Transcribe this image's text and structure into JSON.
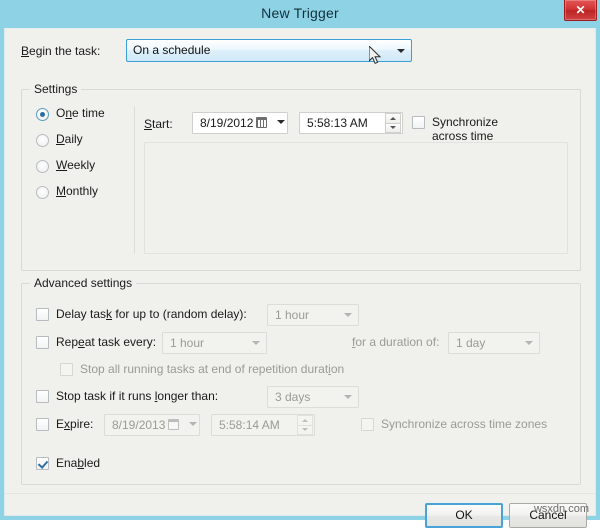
{
  "window": {
    "title": "New Trigger",
    "close_label": "✕",
    "accent_title_bg": "#8ed2e6",
    "body_bg": "#f0f0ec",
    "accent_focus": "#4aa3d6"
  },
  "begin": {
    "label": "Begin the task:",
    "value": "On a schedule"
  },
  "settings": {
    "legend": "Settings",
    "radios": [
      {
        "label_pre": "O",
        "label_acc": "n",
        "label_post": "e time",
        "checked": true
      },
      {
        "label_pre": "",
        "label_acc": "D",
        "label_post": "aily",
        "checked": false
      },
      {
        "label_pre": "",
        "label_acc": "W",
        "label_post": "eekly",
        "checked": false
      },
      {
        "label_pre": "",
        "label_acc": "M",
        "label_post": "onthly",
        "checked": false
      }
    ],
    "start_label": "Start:",
    "start_date": "8/19/2012",
    "start_time": "5:58:13 AM",
    "sync_label": "Synchronize across time zones",
    "sync_checked": false
  },
  "advanced": {
    "legend": "Advanced settings",
    "delay": {
      "label": "Delay task for up to (random delay):",
      "checked": false,
      "value": "1 hour"
    },
    "repeat": {
      "label": "Repeat task every:",
      "checked": false,
      "value": "1 hour",
      "duration_label": "for a duration of:",
      "duration_value": "1 day"
    },
    "stop_all": {
      "label": "Stop all running tasks at end of repetition duration",
      "checked": false,
      "disabled": true
    },
    "stop_longer": {
      "label": "Stop task if it runs longer than:",
      "checked": false,
      "value": "3 days"
    },
    "expire": {
      "label": "Expire:",
      "checked": false,
      "date": "8/19/2013",
      "time": "5:58:14 AM",
      "sync_label": "Synchronize across time zones",
      "sync_checked": false
    }
  },
  "enabled": {
    "label": "Enabled",
    "checked": true
  },
  "buttons": {
    "ok": "OK",
    "cancel": "Cancel"
  },
  "watermark": "wsxdn.com"
}
